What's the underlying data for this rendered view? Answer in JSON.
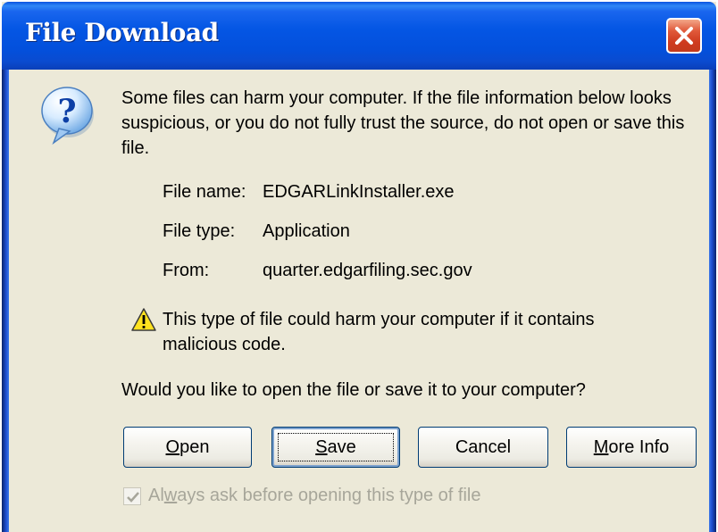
{
  "dialog": {
    "title": "File Download",
    "close_icon": "close-icon",
    "info_icon": "question-mark-balloon-icon",
    "warning_message": "Some files can harm your computer. If the file information below looks suspicious, or you do not fully trust the source, do not open or save this file.",
    "file_name_label": "File name:",
    "file_name": "EDGARLinkInstaller.exe",
    "file_type_label": "File type:",
    "file_type": "Application",
    "from_label": "From:",
    "from": "quarter.edgarfiling.sec.gov",
    "caution_icon": "warning-triangle-icon",
    "caution_text": "This type of file could harm your computer if it contains malicious code.",
    "question": "Would you like to open the file or save it to your computer?",
    "buttons": {
      "open_mnemonic": "O",
      "open_rest": "pen",
      "save_mnemonic": "S",
      "save_rest": "ave",
      "cancel": "Cancel",
      "more_info_mnemonic": "M",
      "more_info_rest": "ore Info"
    },
    "always_ask": {
      "pre": "Al",
      "mnemonic": "w",
      "rest": "ays ask before opening this type of file",
      "checked": true,
      "enabled": false
    }
  },
  "colors": {
    "titlebar": "#0454e2",
    "dialog_bg": "#ece9d8",
    "close_button": "#d6472a",
    "disabled_text": "#a7a69a"
  }
}
